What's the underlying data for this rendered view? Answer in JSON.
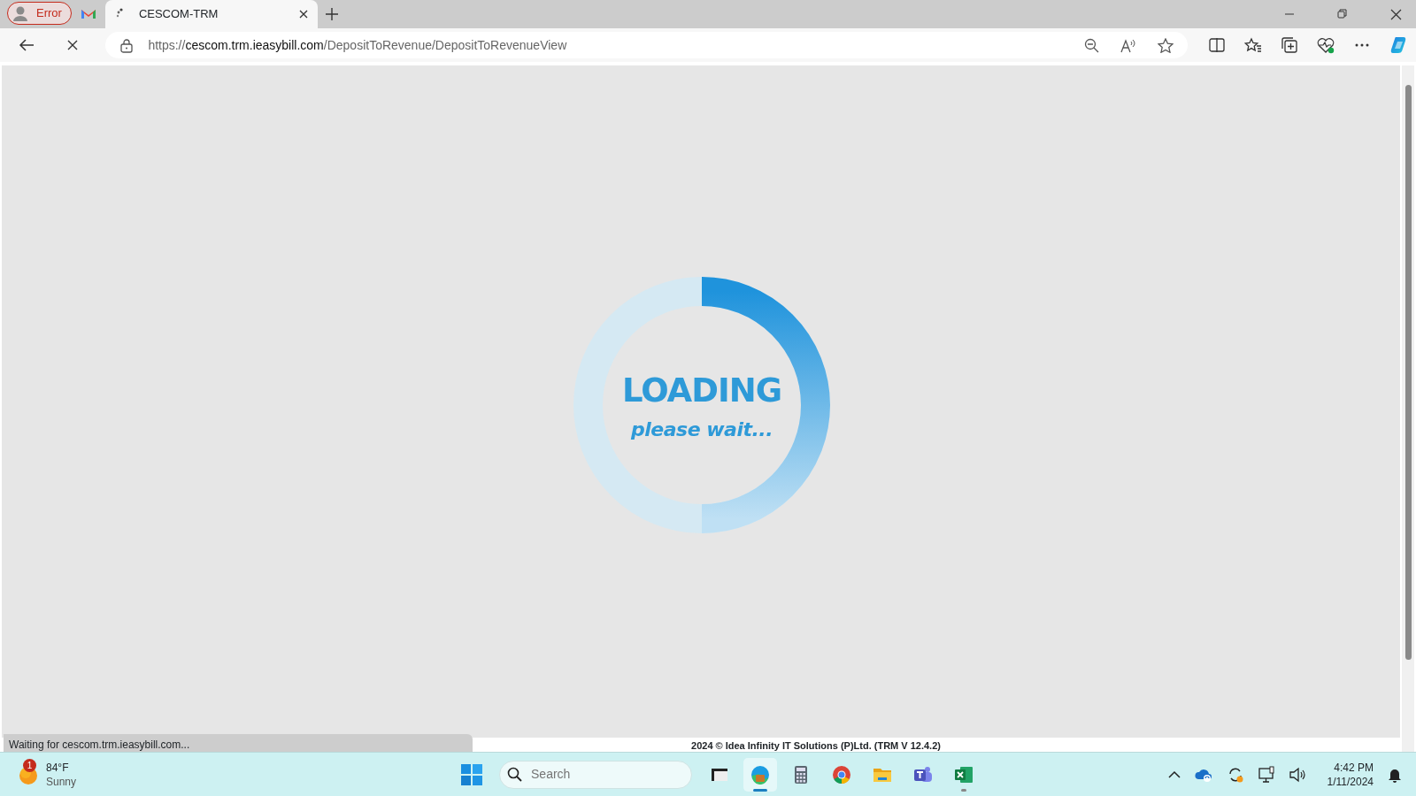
{
  "browser": {
    "profile": "Error",
    "tabs": [
      {
        "kind": "mail",
        "selected": false
      },
      {
        "kind": "page",
        "label": "CESCOM-TRM",
        "selected": true
      }
    ],
    "url": {
      "scheme": "https://",
      "host": "cescom.trm.ieasybill.com",
      "path": "/DepositToRevenue/DepositToRevenueView"
    },
    "status_text": "Waiting for cescom.trm.ieasybill.com..."
  },
  "page": {
    "loader": {
      "title": "LOADING",
      "subtitle": "please wait..."
    },
    "footer": "2024 © Idea Infinity IT Solutions (P)Ltd. (TRM V 12.4.2)"
  },
  "taskbar": {
    "weather": {
      "badge": "1",
      "temperature": "84°F",
      "condition": "Sunny"
    },
    "search": {
      "placeholder": "Search"
    },
    "apps": [
      {
        "kind": "files",
        "selected": false,
        "running": false
      },
      {
        "kind": "edge",
        "selected": true,
        "running": true
      },
      {
        "kind": "calculator",
        "selected": false,
        "running": false
      },
      {
        "kind": "chrome",
        "selected": false,
        "running": false
      },
      {
        "kind": "folder",
        "selected": false,
        "running": false
      },
      {
        "kind": "teams",
        "selected": false,
        "running": false
      },
      {
        "kind": "excel",
        "selected": false,
        "running": true
      }
    ],
    "time": "4:42 PM",
    "date": "1/11/2024"
  }
}
